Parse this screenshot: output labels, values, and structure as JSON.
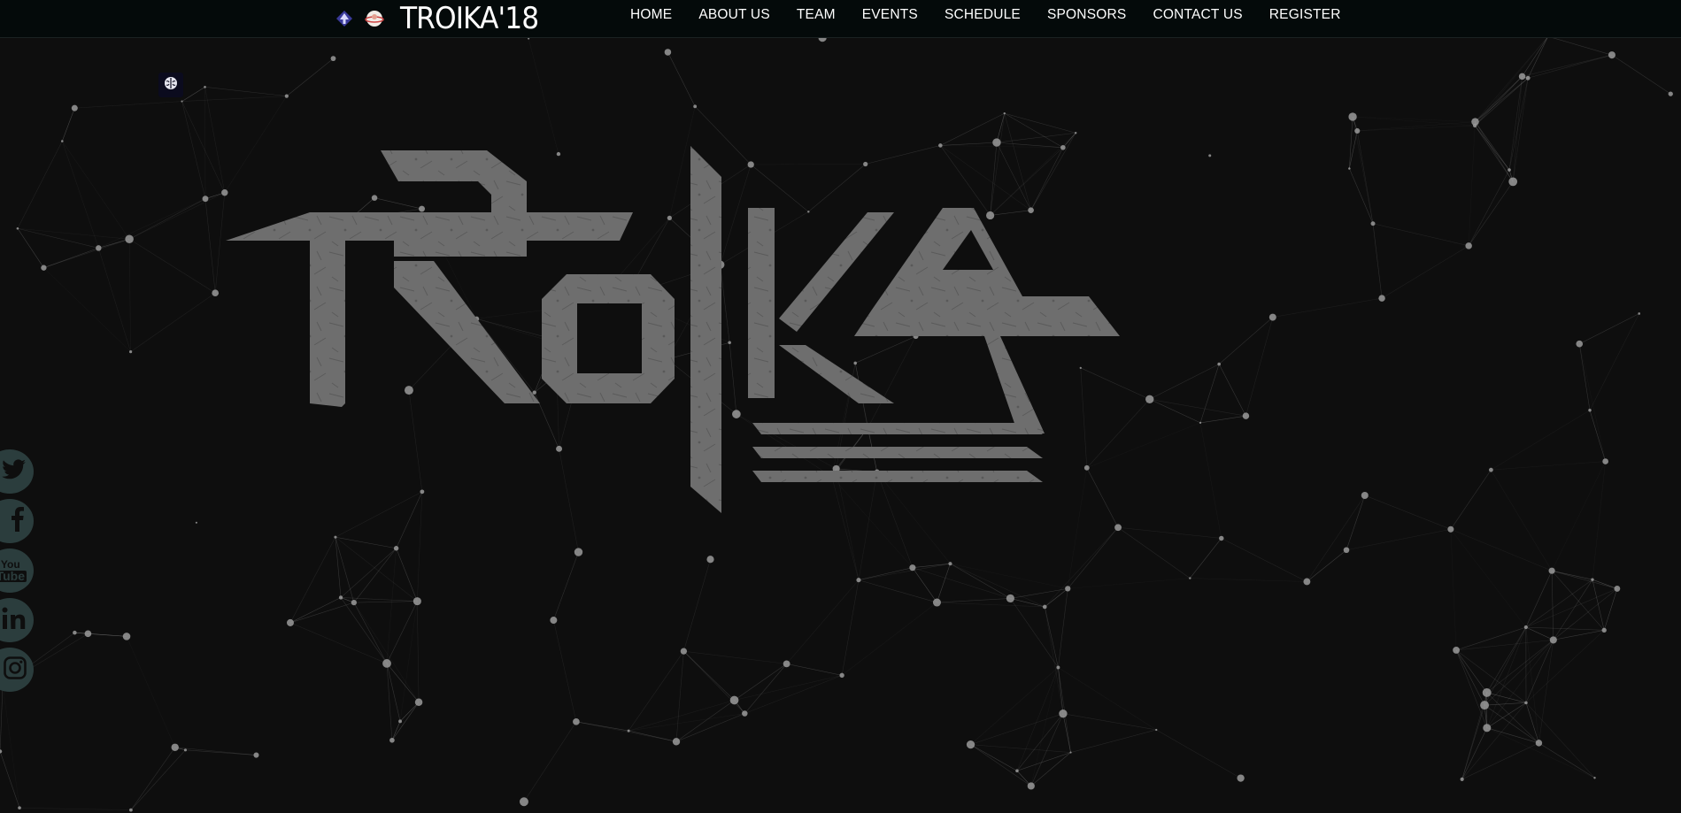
{
  "header": {
    "brand_text": "TROIKA'18",
    "brand_icons": [
      "arrow-emblem-icon",
      "planet-emblem-icon"
    ]
  },
  "nav": {
    "items": [
      "HOME",
      "ABOUT US",
      "TEAM",
      "EVENTS",
      "SCHEDULE",
      "SPONSORS",
      "CONTACT US",
      "REGISTER"
    ]
  },
  "hero": {
    "logo_text": "TROIKA",
    "logo_color": "#6e6e6e"
  },
  "social": {
    "items": [
      "twitter-icon",
      "facebook-icon",
      "youtube-icon",
      "linkedin-icon",
      "instagram-icon"
    ],
    "youtube_label_1": "You",
    "youtube_label_2": "Tube"
  },
  "colors": {
    "background": "#0e0e0e",
    "topbar": "#040a0a",
    "network": "#9a9a9a",
    "social_bg": "#2b3d3d"
  },
  "floating_badge": {
    "icon": "brain-icon"
  }
}
